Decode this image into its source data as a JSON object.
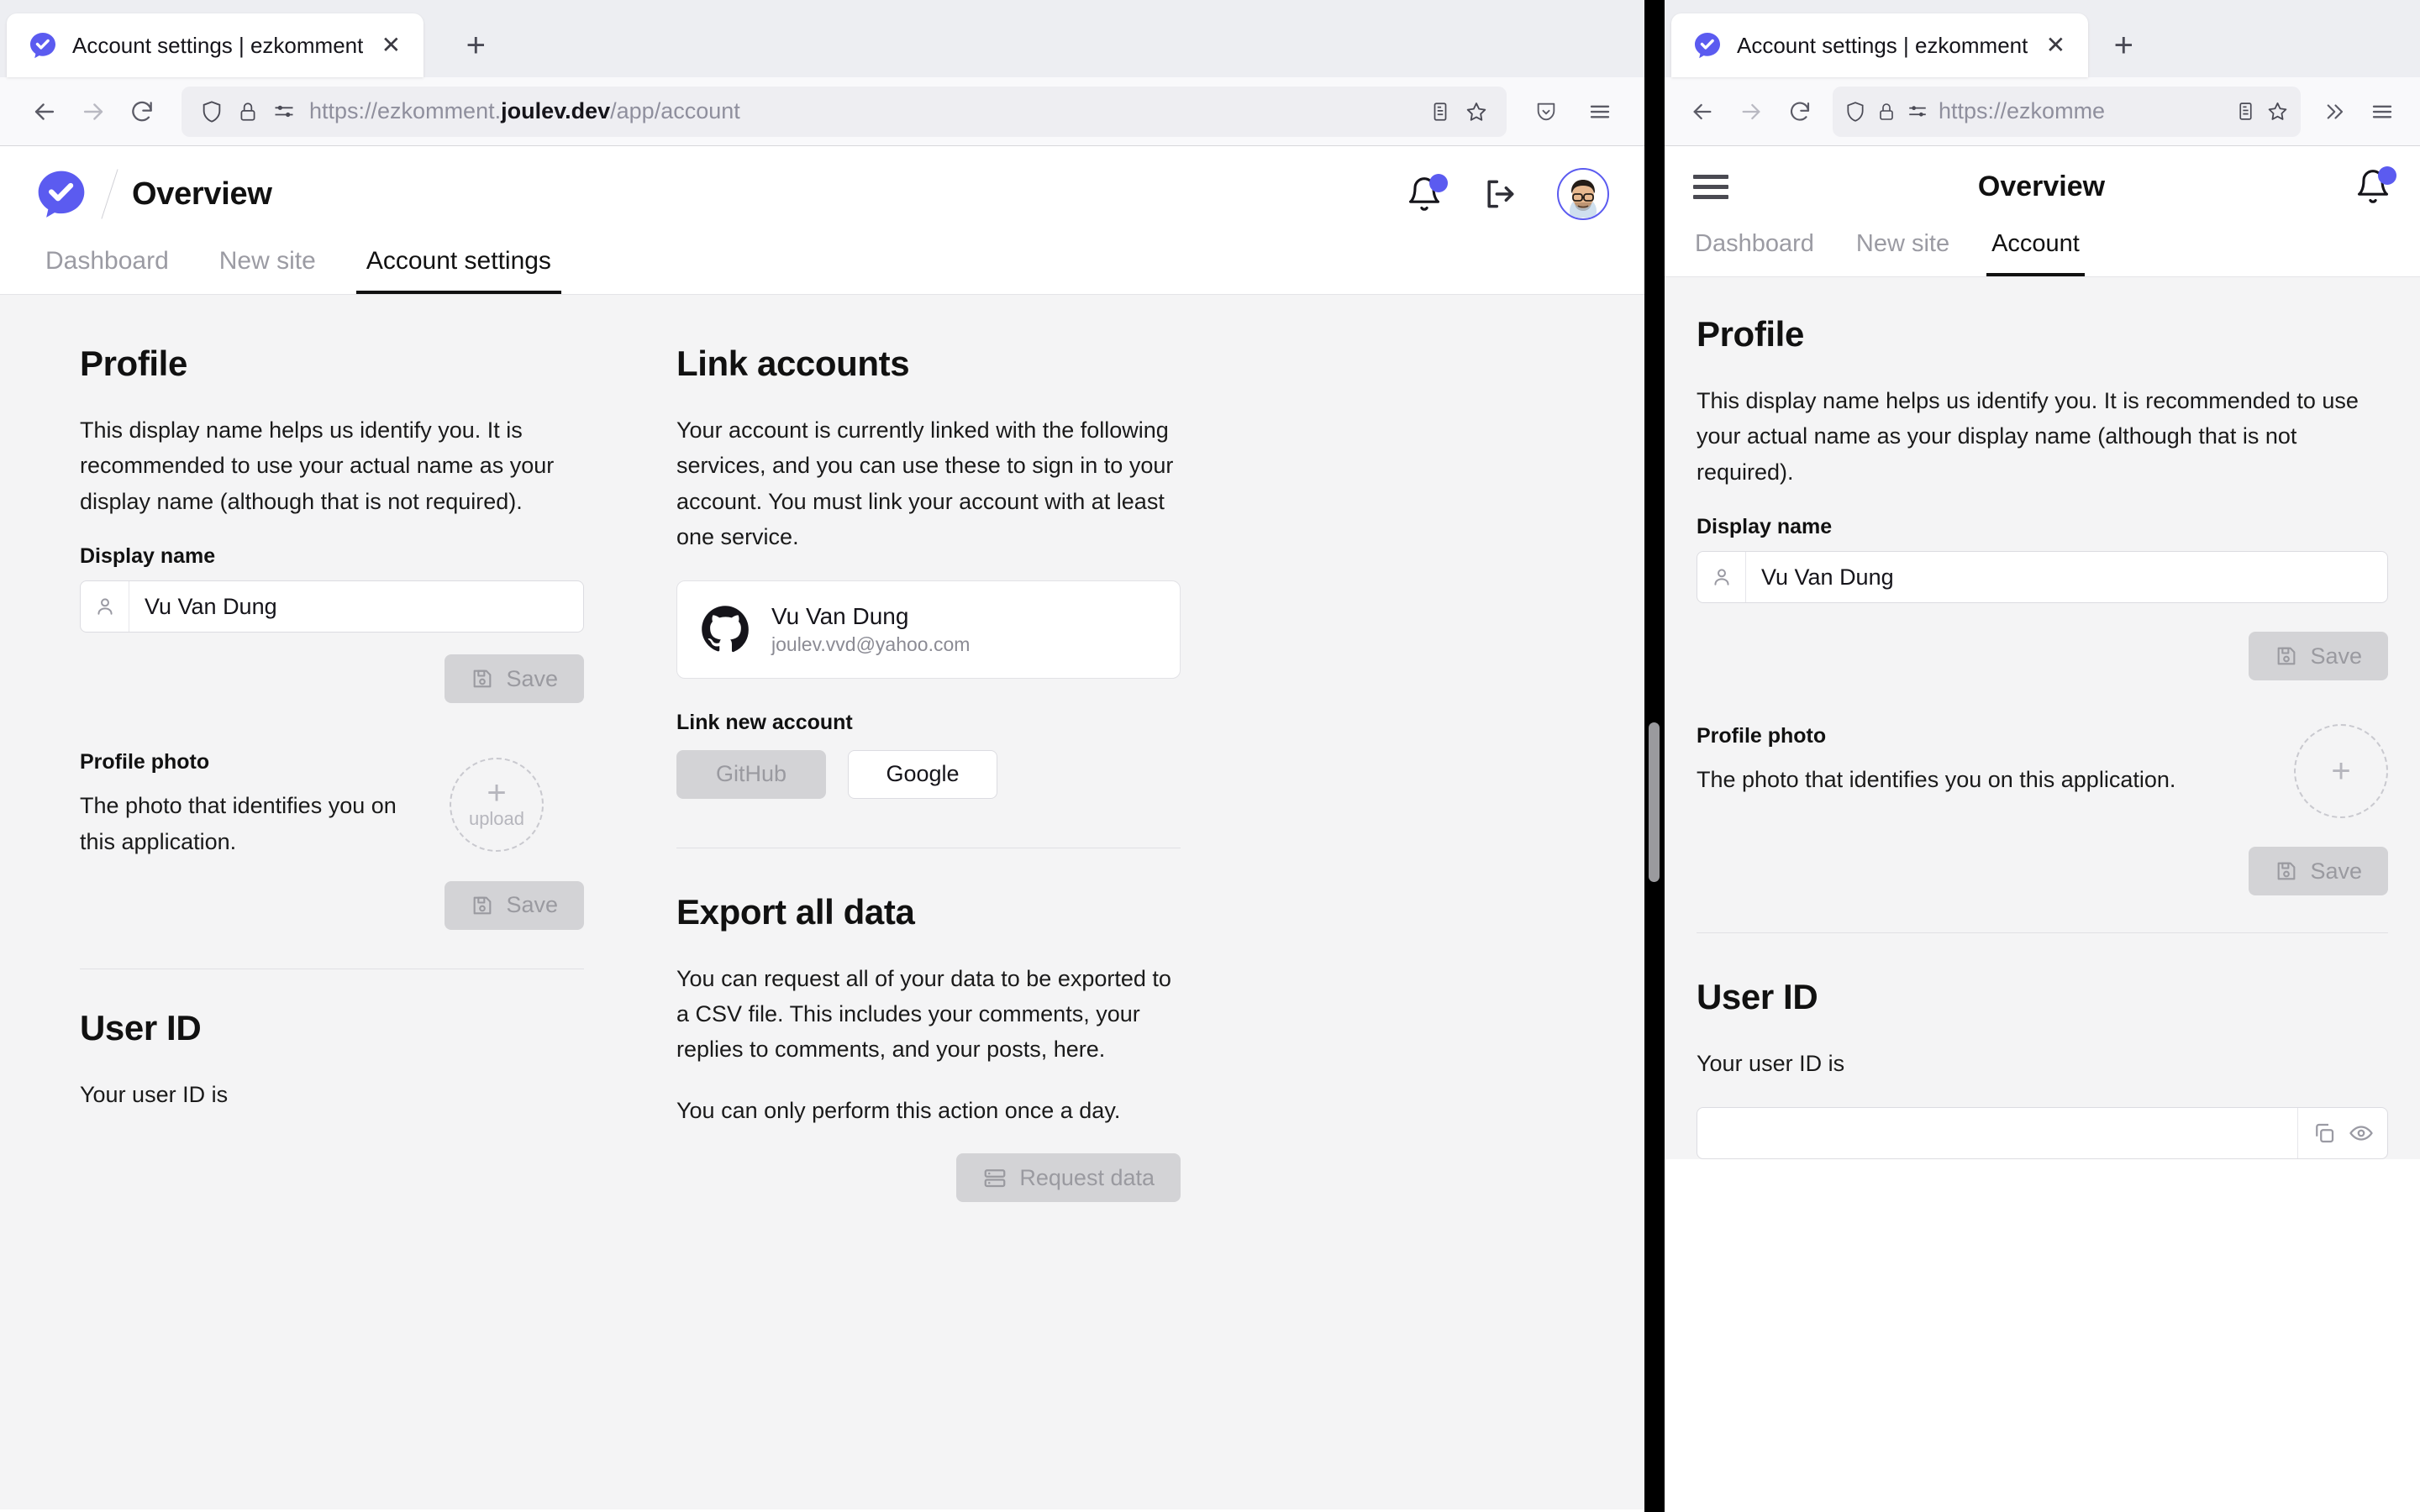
{
  "browser": {
    "tab": {
      "title": "Account settings | ezkomment",
      "favicon_icon": "ezkomment-check-bubble-icon",
      "close_icon": "close-icon"
    },
    "new_tab_label": "+",
    "nav": {
      "back_icon": "arrow-left-icon",
      "forward_icon": "arrow-right-icon",
      "reload_icon": "reload-icon"
    },
    "url": {
      "shield_icon": "shield-icon",
      "lock_icon": "lock-icon",
      "permissions_icon": "permissions-icon",
      "prefix": "https://ezkomment.",
      "domain": "joulev.dev",
      "path": "/app/account",
      "full_left": "https://ezkomment.joulev.dev/app/account",
      "truncated_right": "https://ezkomme",
      "reader_icon": "reader-view-icon",
      "bookmark_icon": "star-icon"
    },
    "right_icons": {
      "pocket_icon": "pocket-icon",
      "menu_icon": "hamburger-menu-icon",
      "overflow_icon": "chevron-double-right-icon"
    }
  },
  "app": {
    "logo_icon": "ezkomment-check-bubble-icon",
    "page_title": "Overview",
    "header_icons": {
      "notifications_icon": "bell-icon",
      "notifications_badge": "",
      "logout_icon": "logout-icon",
      "avatar_icon": "user-avatar"
    },
    "tabs_desktop": [
      {
        "label": "Dashboard",
        "active": false
      },
      {
        "label": "New site",
        "active": false
      },
      {
        "label": "Account settings",
        "active": true
      }
    ],
    "tabs_mobile": [
      {
        "label": "Dashboard",
        "active": false
      },
      {
        "label": "New site",
        "active": false
      },
      {
        "label": "Account",
        "active": true
      }
    ]
  },
  "profile": {
    "heading": "Profile",
    "description": "This display name helps us identify you. It is recommended to use your actual name as your display name (although that is not required).",
    "display_name_label": "Display name",
    "display_name_value": "Vu Van Dung",
    "display_name_icon": "person-icon",
    "save_label": "Save",
    "save_icon": "floppy-disk-icon",
    "photo_label": "Profile photo",
    "photo_description": "The photo that identifies you on this application.",
    "upload_plus": "+",
    "upload_label": "upload",
    "upload_icon": "plus-icon"
  },
  "link_accounts": {
    "heading": "Link accounts",
    "description": "Your account is currently linked with the following services, and you can use these to sign in to your account. You must link your account with at least one service.",
    "linked": [
      {
        "provider_icon": "github-icon",
        "name": "Vu Van Dung",
        "email": "joulev.vvd@yahoo.com"
      }
    ],
    "new_account_label": "Link new account",
    "buttons": [
      {
        "label": "GitHub",
        "state": "disabled"
      },
      {
        "label": "Google",
        "state": "enabled"
      }
    ]
  },
  "export": {
    "heading": "Export all data",
    "paragraph_1": "You can request all of your data to be exported to a CSV file. This includes your comments, your replies to comments, and your posts, here.",
    "paragraph_2": "You can only perform this action once a day.",
    "request_label": "Request data",
    "request_icon": "server-icon"
  },
  "user_id": {
    "heading": "User ID",
    "description": "Your user ID is",
    "copy_icon": "copy-icon",
    "eye_icon": "eye-icon"
  },
  "colors": {
    "accent": "#5b5bf0",
    "page_bg": "#f4f4f5",
    "chrome_bg": "#f9f9fb",
    "tabbar_bg": "#edeef2",
    "text": "#15141a",
    "muted": "#9b9ba3",
    "disabled_bg": "#d3d3d6"
  }
}
